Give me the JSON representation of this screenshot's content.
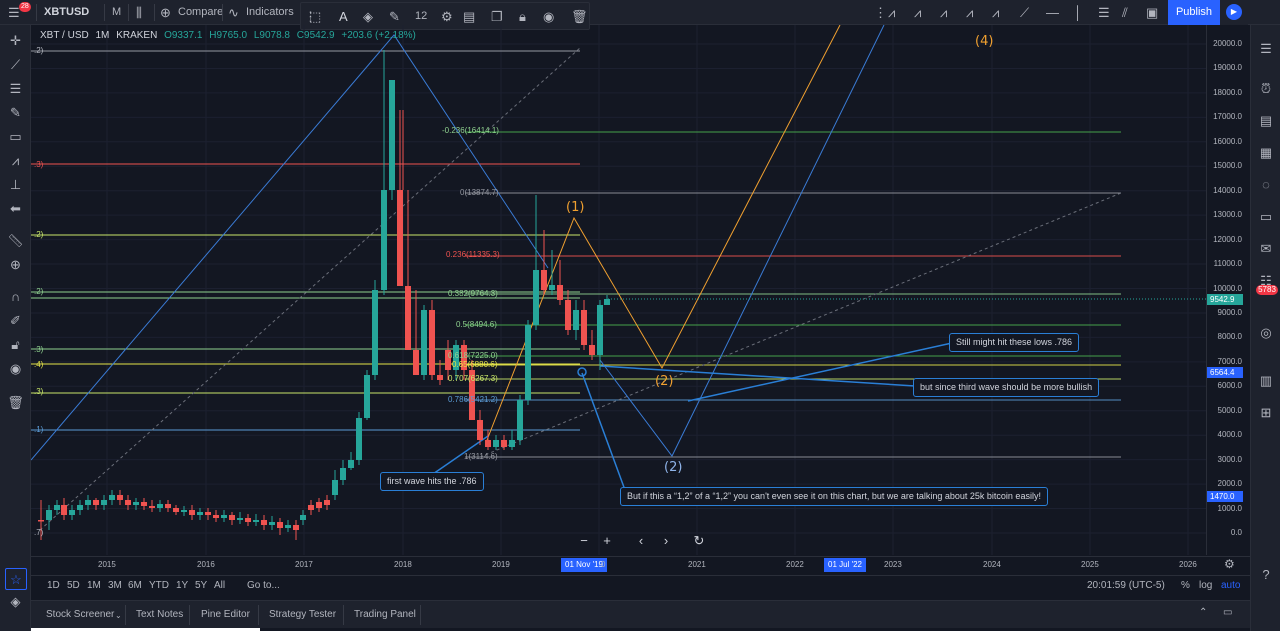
{
  "topbar": {
    "notif_count": "28",
    "symbol": "XBTUSD",
    "interval": "M",
    "compare_label": "Compare",
    "indicators_label": "Indicators",
    "font_size": "12",
    "publish_label": "Publish"
  },
  "legend": {
    "pair": "XBT / USD",
    "interval": "1M",
    "exchange": "KRAKEN",
    "open": "O9337.1",
    "high": "H9765.0",
    "low": "L9078.8",
    "close": "C9542.9",
    "change": "+203.6 (+2.18%)"
  },
  "right_badge": "5783",
  "y_axis": {
    "ticks": [
      "20000.0",
      "19000.0",
      "18000.0",
      "17000.0",
      "16000.0",
      "15000.0",
      "14000.0",
      "13000.0",
      "12000.0",
      "11000.0",
      "10000.0",
      "9000.0",
      "8000.0",
      "7000.0",
      "6000.0",
      "5000.0",
      "4000.0",
      "3000.0",
      "2000.0",
      "1000.0",
      "0.0"
    ],
    "price_label": "9542.9",
    "level_label": "6564.4",
    "low_label": "1470.0"
  },
  "x_axis": {
    "ticks": [
      "2015",
      "2016",
      "2017",
      "2018",
      "2019",
      "2021",
      "2022",
      "2023",
      "2024",
      "2025",
      "2026"
    ],
    "cursor_label": "01 Nov '19",
    "cursor_tail": "0",
    "end_label": "01 Jul '22"
  },
  "fib_left": [
    ".2)",
    ".3)",
    ".2)",
    ".2)",
    ".3)",
    ".4)",
    ".3)",
    ".1)",
    ".7)"
  ],
  "fib_right": {
    "neg": "-0.236(16414.1)",
    "zero": "0(13874.7)",
    "f236": "0.236(11335.3)",
    "f382": "0.382(9764.3)",
    "f5": "0.5(8494.6)",
    "f618": "0.618(7225.0)",
    "f65": "0.65(6880.6)",
    "f707": "0.707(6267.3)",
    "f786": "0.786(5421.2)",
    "one": "1(3114.6)"
  },
  "waves": {
    "w1": "(1)",
    "w2a": "(2)",
    "w2b": "(2)",
    "w4": "(4)"
  },
  "callouts": {
    "c1": "first wave hits the .786",
    "c2": "Still might hit these lows .786",
    "c3": "but since third wave should be more bullish",
    "c4": "But if this a “1,2” of a “1,2”  you can't even see it on this chart, but we are talking about 25k bitcoin easily!"
  },
  "range_bar": {
    "items": [
      "1D",
      "5D",
      "1M",
      "3M",
      "6M",
      "YTD",
      "1Y",
      "5Y",
      "All"
    ],
    "goto": "Go to...",
    "time": "20:01:59 (UTC-5)",
    "pct": "%",
    "log": "log",
    "auto": "auto"
  },
  "bottom_tabs": [
    "Stock Screener",
    "Text Notes",
    "Pine Editor",
    "Strategy Tester",
    "Trading Panel"
  ],
  "colors": {
    "bg": "#131722",
    "up": "#26a69a",
    "down": "#ef5350",
    "accent": "#2962ff",
    "wave_orange": "#f0a030",
    "wave_blue": "#8fb3e8",
    "callout_border": "#2a7fd6",
    "auto_blue": "#2962ff"
  },
  "chart_data": {
    "type": "candlestick",
    "interval": "1M",
    "y_axis_range": [
      0,
      20000
    ],
    "fib_levels": {
      "-0.236": 16414.1,
      "0": 13874.7,
      "0.236": 11335.3,
      "0.382": 9764.3,
      "0.5": 8494.6,
      "0.618": 7225.0,
      "0.65": 6880.6,
      "0.707": 6267.3,
      "0.786": 5421.2,
      "1": 3114.6
    },
    "last_close": 9542.9
  }
}
